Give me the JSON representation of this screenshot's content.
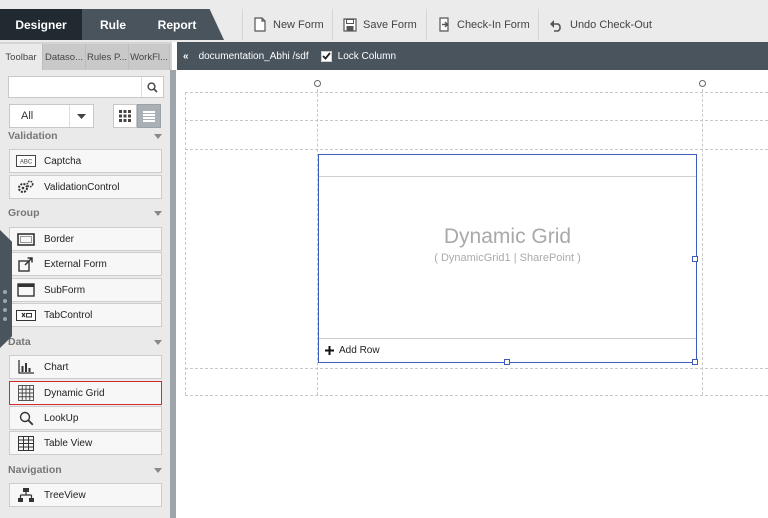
{
  "top_tabs": [
    {
      "label": "Designer",
      "active": true
    },
    {
      "label": "Rule",
      "active": false
    },
    {
      "label": "Report",
      "active": false
    }
  ],
  "toolbar": {
    "new_form": "New Form",
    "save_form": "Save Form",
    "check_in_form": "Check-In Form",
    "undo_check_out": "Undo Check-Out"
  },
  "side_tabs": [
    {
      "label": "Toolbar",
      "active": true
    },
    {
      "label": "Dataso...",
      "active": false
    },
    {
      "label": "Rules P...",
      "active": false
    },
    {
      "label": "WorkFl...",
      "active": false
    }
  ],
  "search": {
    "placeholder": ""
  },
  "filter": {
    "selected": "All"
  },
  "sections": {
    "validation": "Validation",
    "group": "Group",
    "data": "Data",
    "navigation": "Navigation"
  },
  "items": {
    "captcha": "Captcha",
    "validation_control": "ValidationControl",
    "border": "Border",
    "external_form": "External Form",
    "subform": "SubForm",
    "tab_control": "TabControl",
    "chart": "Chart",
    "dynamic_grid": "Dynamic Grid",
    "lookup": "LookUp",
    "table_view": "Table View",
    "tree_view": "TreeView"
  },
  "canvas_header": {
    "path": "documentation_Abhi /sdf",
    "lock_column": "Lock Column",
    "lock_checked": true
  },
  "grid_control": {
    "title": "Dynamic Grid",
    "subtitle": "( DynamicGrid1 | SharePoint )",
    "add_row": "Add Row"
  },
  "colors": {
    "dark": "#222a31",
    "slate": "#4a545d",
    "selection_blue": "#3b5db8",
    "selected_item_border": "#d62b2b"
  }
}
